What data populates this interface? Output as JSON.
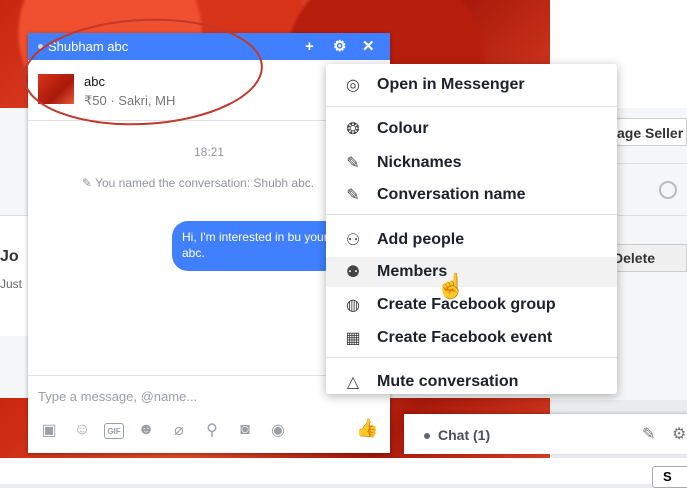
{
  "background": {
    "seller_btn": "age Seller",
    "delete_btn": "Delete",
    "post_author": "Jo",
    "post_time": "Just",
    "bottom_btn": "S"
  },
  "chat": {
    "title": "Shubham   abc",
    "header_icons": [
      "add-icon",
      "gear-icon",
      "close-icon"
    ],
    "product": {
      "name": "abc",
      "price_location": "₹50 · Sakri, MH"
    },
    "time": "18:21",
    "system_message": "You named the conversation: Shubh abc.",
    "message": "Hi, I'm interested in bu your abc.",
    "composer_placeholder": "Type a message, @name...",
    "gif_label": "GIF"
  },
  "menu": {
    "items": [
      {
        "label": "Open in Messenger",
        "icon": "messenger-icon"
      },
      {
        "label": "Colour",
        "icon": "palette-icon"
      },
      {
        "label": "Nicknames",
        "icon": "pencil-icon"
      },
      {
        "label": "Conversation name",
        "icon": "pencil-icon"
      },
      {
        "label": "Add people",
        "icon": "add-person-icon"
      },
      {
        "label": "Members",
        "icon": "group-icon"
      },
      {
        "label": "Create Facebook group",
        "icon": "group-circle-icon"
      },
      {
        "label": "Create Facebook event",
        "icon": "calendar-icon"
      },
      {
        "label": "Mute conversation",
        "icon": "bell-icon"
      }
    ],
    "hovered": "Members"
  },
  "chatbar": {
    "label": "Chat (1)"
  },
  "colors": {
    "header_blue": "#4080ff",
    "annotation": "#c0392b"
  }
}
